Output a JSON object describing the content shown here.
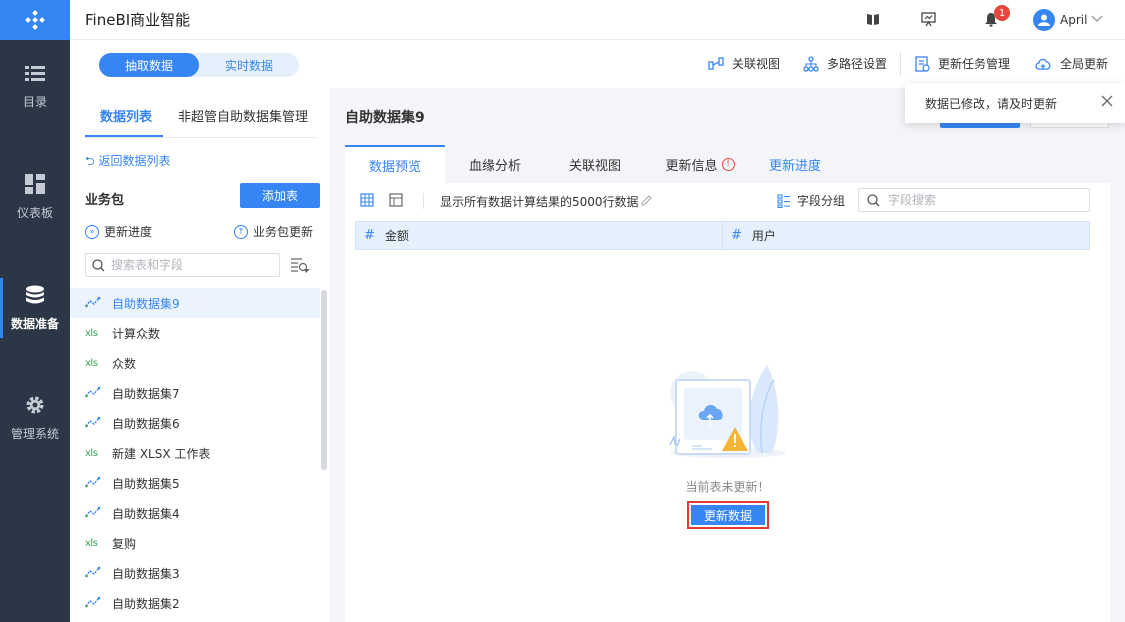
{
  "app": {
    "title": "FineBI商业智能",
    "user": "April",
    "notification_count": "1"
  },
  "leftnav": {
    "items": [
      {
        "label": "目录",
        "icon": "list-icon"
      },
      {
        "label": "仪表板",
        "icon": "dashboard-icon"
      },
      {
        "label": "数据准备",
        "icon": "database-icon",
        "active": true
      },
      {
        "label": "管理系统",
        "icon": "gear-icon"
      }
    ]
  },
  "toolbar": {
    "mode_extract": "抽取数据",
    "mode_realtime": "实时数据",
    "relation_view": "关联视图",
    "multi_path": "多路径设置",
    "task_manage": "更新任务管理",
    "global_update": "全局更新"
  },
  "leftpanel": {
    "tab_list": "数据列表",
    "tab_manage": "非超管自助数据集管理",
    "back": "返回数据列表",
    "package_title": "业务包",
    "add_table": "添加表",
    "update_progress": "更新进度",
    "package_update": "业务包更新",
    "search_placeholder": "搜索表和字段",
    "items": [
      {
        "label": "自助数据集9",
        "type": "self"
      },
      {
        "label": "计算众数",
        "type": "xls"
      },
      {
        "label": "众数",
        "type": "xls"
      },
      {
        "label": "自助数据集7",
        "type": "self"
      },
      {
        "label": "自助数据集6",
        "type": "self"
      },
      {
        "label": "新建 XLSX 工作表",
        "type": "xls"
      },
      {
        "label": "自助数据集5",
        "type": "self"
      },
      {
        "label": "自助数据集4",
        "type": "self"
      },
      {
        "label": "复购",
        "type": "xls"
      },
      {
        "label": "自助数据集3",
        "type": "self"
      },
      {
        "label": "自助数据集2",
        "type": "self"
      }
    ],
    "xls_tag": "xls"
  },
  "main": {
    "title": "自助数据集9",
    "tabs": [
      "数据预览",
      "血缘分析",
      "关联视图",
      "更新信息",
      "更新进度"
    ],
    "info_mark": "!",
    "show_all": "显示所有数据计算结果的5000行数据",
    "field_group": "字段分组",
    "field_search_placeholder": "字段搜索",
    "columns": [
      "金额",
      "用户"
    ],
    "col_mark": "#",
    "empty_text": "当前表未更新！",
    "update_button": "更新数据"
  },
  "toast": {
    "message": "数据已修改，请及时更新"
  },
  "colors": {
    "primary": "#3685f2",
    "nav_bg": "#2b3646",
    "alert": "#e8453c"
  }
}
